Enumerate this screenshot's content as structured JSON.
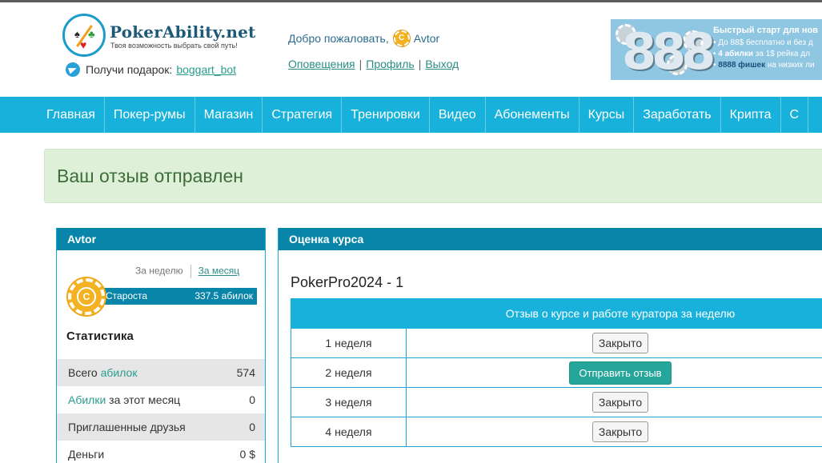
{
  "header": {
    "logo_name": "PokerAbility.net",
    "logo_tagline": "Твоя возможность выбрать свой путь!",
    "gift_label": "Получи подарок:",
    "gift_link": "boggart_bot",
    "welcome_text": "Добро пожаловать,",
    "username": "Avtor",
    "links": [
      "Оповещения",
      "Профиль",
      "Выход"
    ],
    "banner": {
      "digits": "888",
      "title": "Быстрый старт для нов",
      "line1": "До 88$ бесплатно и без д",
      "line2_a": "4 абилки",
      "line2_b": " за 1$ рейка дл",
      "line3_a": "8888 фишек",
      "line3_b": " на низких ли"
    }
  },
  "nav": [
    "Главная",
    "Покер-румы",
    "Магазин",
    "Стратегия",
    "Тренировки",
    "Видео",
    "Абонементы",
    "Курсы",
    "Заработать",
    "Крипта",
    "С"
  ],
  "alert": {
    "text": "Ваш отзыв отправлен"
  },
  "sidebar": {
    "title": "Avtor",
    "period_week": "За неделю",
    "period_month": "За месяц",
    "rank_name": "Староста",
    "rank_value": "337.5 абилок",
    "coin_letter": "C",
    "stats_title": "Статистика",
    "stats": [
      {
        "label": "Всего ",
        "label_link": "абилок",
        "label_rest": "",
        "value": "574"
      },
      {
        "label": "",
        "label_link": "Абилки",
        "label_rest": " за этот месяц",
        "value": "0"
      },
      {
        "label": "Приглашенные друзья",
        "label_link": "",
        "label_rest": "",
        "value": "0"
      },
      {
        "label": "Деньги",
        "label_link": "",
        "label_rest": "",
        "value": "0 $"
      }
    ]
  },
  "main": {
    "panel_title": "Оценка курса",
    "course_name": "PokerPro2024 - 1",
    "table_header_week": "",
    "table_header_review": "Отзыв о курсе и работе куратора за неделю",
    "rows": [
      {
        "week": "1 неделя",
        "action": "Закрыто",
        "type": "closed"
      },
      {
        "week": "2 неделя",
        "action": "Отправить отзыв",
        "type": "send"
      },
      {
        "week": "3 неделя",
        "action": "Закрыто",
        "type": "closed"
      },
      {
        "week": "4 неделя",
        "action": "Закрыто",
        "type": "closed"
      }
    ]
  },
  "colors": {
    "nav_bg": "#17b1dc",
    "panel_head": "#0985a9",
    "alert_bg": "#dff0d8",
    "send_button": "#26a69a",
    "coin": "#f4b223"
  }
}
